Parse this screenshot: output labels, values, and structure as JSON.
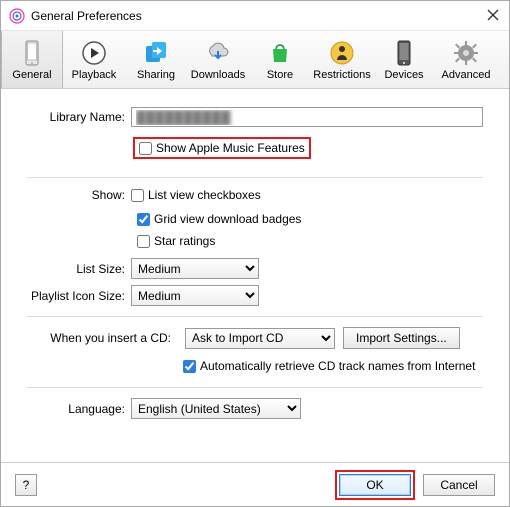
{
  "window": {
    "title": "General Preferences"
  },
  "toolbar": {
    "items": [
      {
        "label": "General"
      },
      {
        "label": "Playback"
      },
      {
        "label": "Sharing"
      },
      {
        "label": "Downloads"
      },
      {
        "label": "Store"
      },
      {
        "label": "Restrictions"
      },
      {
        "label": "Devices"
      },
      {
        "label": "Advanced"
      }
    ]
  },
  "labels": {
    "library_name": "Library Name:",
    "show": "Show:",
    "list_size": "List Size:",
    "playlist_icon_size": "Playlist Icon Size:",
    "cd_insert": "When you insert a CD:",
    "language": "Language:"
  },
  "fields": {
    "library_name_value": "██████████",
    "show_apple_music": "Show Apple Music Features",
    "list_view_checkboxes": "List view checkboxes",
    "grid_view_badges": "Grid view download badges",
    "star_ratings": "Star ratings",
    "list_size_value": "Medium",
    "playlist_icon_size_value": "Medium",
    "cd_action": "Ask to Import CD",
    "import_settings": "Import Settings...",
    "auto_retrieve": "Automatically retrieve CD track names from Internet",
    "language_value": "English (United States)"
  },
  "footer": {
    "help": "?",
    "ok": "OK",
    "cancel": "Cancel"
  }
}
